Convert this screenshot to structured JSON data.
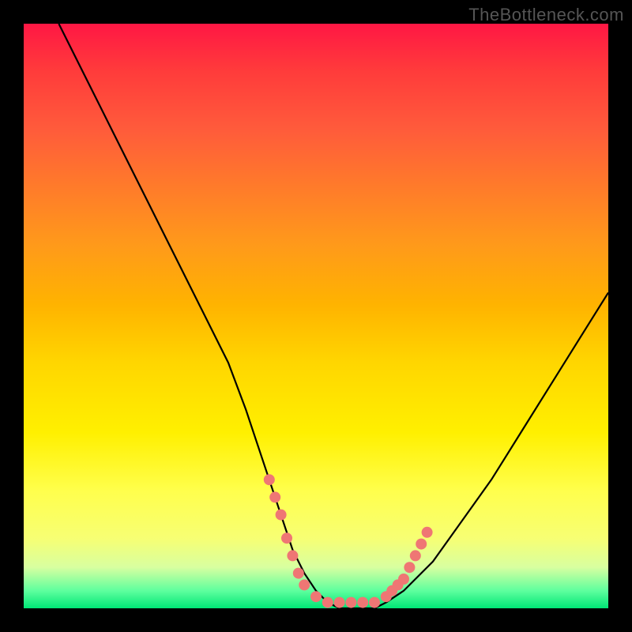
{
  "watermark": "TheBottleneck.com",
  "colors": {
    "background": "#000000",
    "curve_stroke": "#000000",
    "dot_fill": "#ef7674",
    "gradient_top": "#ff1744",
    "gradient_bottom": "#00e676"
  },
  "chart_data": {
    "type": "line",
    "title": "",
    "xlabel": "",
    "ylabel": "",
    "xlim": [
      0,
      100
    ],
    "ylim": [
      0,
      100
    ],
    "series": [
      {
        "name": "bottleneck-curve",
        "x": [
          6,
          10,
          15,
          20,
          25,
          30,
          35,
          38,
          40,
          42,
          44,
          46,
          48,
          50,
          52,
          54,
          56,
          58,
          60,
          62,
          65,
          70,
          75,
          80,
          85,
          90,
          95,
          100
        ],
        "y": [
          100,
          92,
          82,
          72,
          62,
          52,
          42,
          34,
          28,
          22,
          16,
          10,
          6,
          3,
          1,
          0,
          0,
          0,
          0,
          1,
          3,
          8,
          15,
          22,
          30,
          38,
          46,
          54
        ]
      }
    ],
    "scatter_dots": {
      "name": "highlight-points",
      "points": [
        {
          "x": 42,
          "y": 22
        },
        {
          "x": 43,
          "y": 19
        },
        {
          "x": 44,
          "y": 16
        },
        {
          "x": 45,
          "y": 12
        },
        {
          "x": 46,
          "y": 9
        },
        {
          "x": 47,
          "y": 6
        },
        {
          "x": 48,
          "y": 4
        },
        {
          "x": 50,
          "y": 2
        },
        {
          "x": 52,
          "y": 1
        },
        {
          "x": 54,
          "y": 1
        },
        {
          "x": 56,
          "y": 1
        },
        {
          "x": 58,
          "y": 1
        },
        {
          "x": 60,
          "y": 1
        },
        {
          "x": 62,
          "y": 2
        },
        {
          "x": 63,
          "y": 3
        },
        {
          "x": 64,
          "y": 4
        },
        {
          "x": 65,
          "y": 5
        },
        {
          "x": 66,
          "y": 7
        },
        {
          "x": 67,
          "y": 9
        },
        {
          "x": 68,
          "y": 11
        },
        {
          "x": 69,
          "y": 13
        }
      ]
    }
  }
}
